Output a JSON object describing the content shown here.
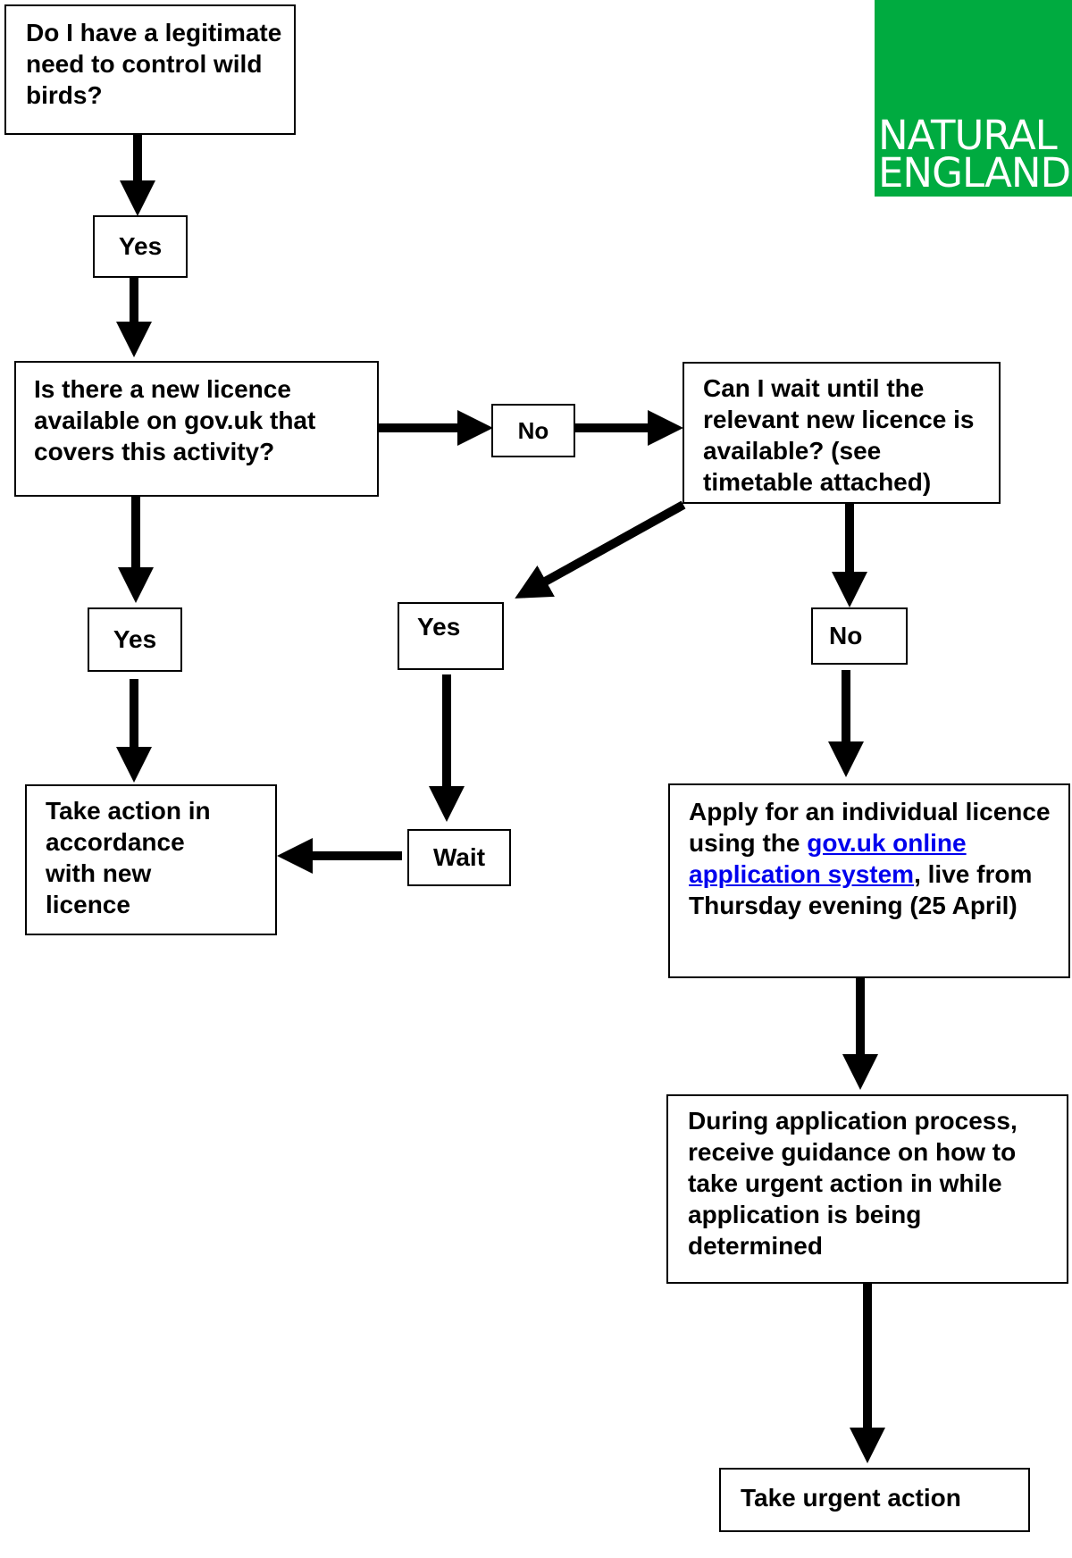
{
  "logo": {
    "line1": "NATURAL",
    "line2": "ENGLAND",
    "color": "#00ab40"
  },
  "nodes": {
    "q_legitimate_need": "Do I have a legitimate need to control wild birds?",
    "yes_1": "Yes",
    "q_new_licence": "Is there a new licence available on gov.uk that covers this activity?",
    "no_1": "No",
    "q_can_wait": "Can I wait until the relevant new licence is available? (see timetable attached)",
    "yes_2": "Yes",
    "yes_3": "Yes",
    "no_2": "No",
    "take_action": "Take action in accordance with new licence",
    "wait": "Wait",
    "apply": {
      "before": "Apply for an individual licence using the ",
      "link": "gov.uk online application system",
      "after": ", live from Thursday evening (25 April)",
      "link_color": "#0000ee"
    },
    "during": "During application process, receive guidance on how to take urgent action in while application is being determined",
    "urgent": "Take urgent action"
  }
}
